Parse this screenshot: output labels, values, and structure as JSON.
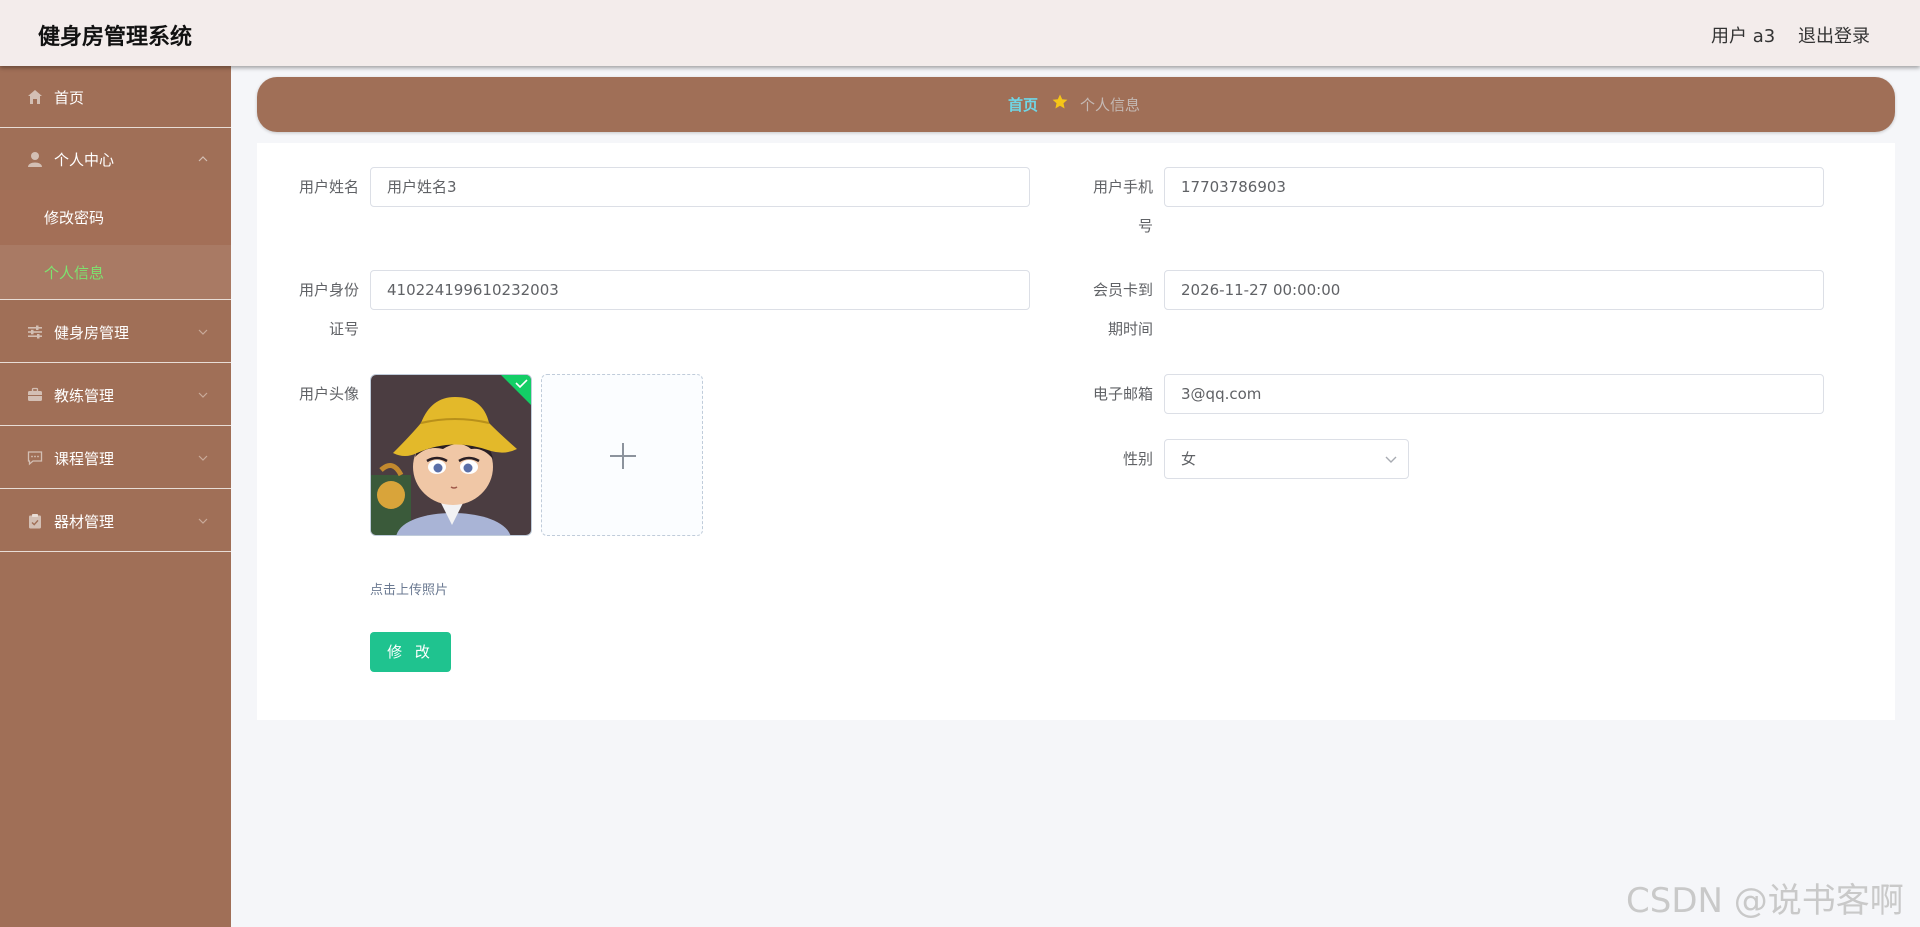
{
  "header": {
    "title": "健身房管理系统",
    "user_label": "用户 a3",
    "logout_label": "退出登录"
  },
  "sidebar": {
    "items": [
      {
        "label": "首页",
        "icon": "home-icon"
      },
      {
        "label": "个人中心",
        "icon": "user-icon",
        "expanded": true,
        "children": [
          {
            "label": "修改密码"
          },
          {
            "label": "个人信息",
            "active": true
          }
        ]
      },
      {
        "label": "健身房管理",
        "icon": "sliders-icon"
      },
      {
        "label": "教练管理",
        "icon": "briefcase-icon"
      },
      {
        "label": "课程管理",
        "icon": "chat-icon"
      },
      {
        "label": "器材管理",
        "icon": "clipboard-icon"
      }
    ]
  },
  "breadcrumb": {
    "home": "首页",
    "current": "个人信息"
  },
  "form": {
    "name_label": "用户姓名",
    "name_value": "用户姓名3",
    "phone_label_line1": "用户手机",
    "phone_label_line2": "号",
    "phone_value": "17703786903",
    "idcard_label_line1": "用户身份",
    "idcard_label_line2": "证号",
    "idcard_value": "410224199610232003",
    "card_expire_label_line1": "会员卡到",
    "card_expire_label_line2": "期时间",
    "card_expire_value": "2026-11-27 00:00:00",
    "avatar_label": "用户头像",
    "email_label": "电子邮箱",
    "email_value": "3@qq.com",
    "gender_label": "性别",
    "gender_value": "女",
    "upload_hint": "点击上传照片",
    "submit_label": "修 改"
  },
  "colors": {
    "sidebar_bg": "#a06f57",
    "header_bg": "#f3eceb",
    "active_menu_text": "#7de36f",
    "submit_button": "#1fc38f",
    "breadcrumb_home": "#6fd6e6"
  },
  "watermark": "CSDN @说书客啊"
}
